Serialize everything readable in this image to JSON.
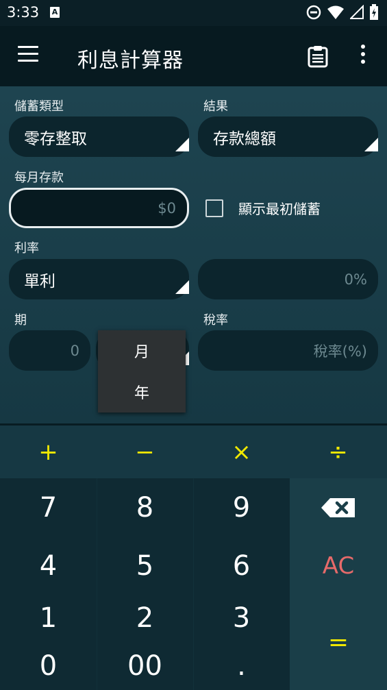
{
  "status_bar": {
    "time": "3:33",
    "a_badge": "A"
  },
  "app_bar": {
    "title": "利息計算器",
    "icons": [
      "menu-icon",
      "clipboard-icon",
      "more-vert-icon"
    ]
  },
  "form": {
    "savings_type": {
      "label": "儲蓄類型",
      "value": "零存整取"
    },
    "result": {
      "label": "結果",
      "value": "存款總額"
    },
    "monthly_deposit": {
      "label": "每月存款",
      "placeholder": "$0"
    },
    "show_initial": {
      "label": "顯示最初儲蓄",
      "checked": false
    },
    "interest": {
      "label": "利率",
      "type_value": "單利",
      "rate_placeholder": "0%"
    },
    "period": {
      "label": "期",
      "placeholder": "0"
    },
    "tax": {
      "label": "稅率",
      "placeholder": "稅率(%)"
    }
  },
  "period_popup": {
    "items": [
      "月",
      "年"
    ]
  },
  "keypad": {
    "ops": [
      "+",
      "−",
      "×",
      "÷"
    ],
    "rows": [
      [
        "7",
        "8",
        "9"
      ],
      [
        "4",
        "5",
        "6"
      ],
      [
        "1",
        "2",
        "3"
      ],
      [
        "0",
        "00",
        "."
      ]
    ],
    "ac": "AC",
    "equals": "="
  },
  "colors": {
    "accent_yellow": "#f0e800",
    "ac_red": "#e66a6a",
    "background": "#0f2a33"
  }
}
